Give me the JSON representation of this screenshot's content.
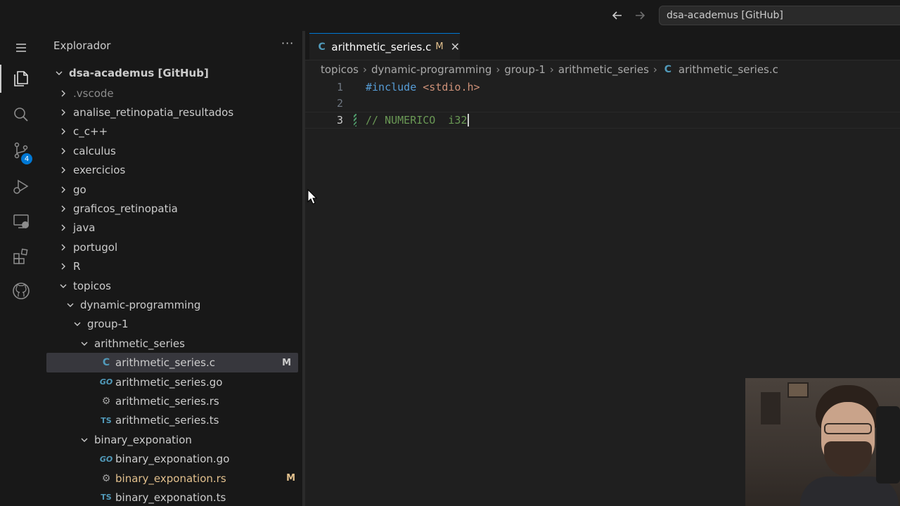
{
  "titlebar": {
    "search_text": "dsa-academus [GitHub]"
  },
  "activitybar": {
    "items": [
      "menu-icon",
      "files-icon",
      "search-icon",
      "source-control-icon",
      "run-debug-icon",
      "remote-explorer-icon",
      "extensions-icon",
      "github-icon"
    ],
    "source_control_badge": "4"
  },
  "sidebar": {
    "title": "Explorador",
    "more": "···",
    "root": "dsa-academus [GitHub]",
    "items": [
      {
        "label": ".vscode",
        "depth": 0,
        "kind": "folder",
        "expanded": false
      },
      {
        "label": "analise_retinopatia_resultados",
        "depth": 0,
        "kind": "folder",
        "expanded": false
      },
      {
        "label": "c_c++",
        "depth": 0,
        "kind": "folder",
        "expanded": false
      },
      {
        "label": "calculus",
        "depth": 0,
        "kind": "folder",
        "expanded": false
      },
      {
        "label": "exercicios",
        "depth": 0,
        "kind": "folder",
        "expanded": false
      },
      {
        "label": "go",
        "depth": 0,
        "kind": "folder",
        "expanded": false
      },
      {
        "label": "graficos_retinopatia",
        "depth": 0,
        "kind": "folder",
        "expanded": false
      },
      {
        "label": "java",
        "depth": 0,
        "kind": "folder",
        "expanded": false
      },
      {
        "label": "portugol",
        "depth": 0,
        "kind": "folder",
        "expanded": false
      },
      {
        "label": "R",
        "depth": 0,
        "kind": "folder",
        "expanded": false
      },
      {
        "label": "topicos",
        "depth": 0,
        "kind": "folder",
        "expanded": true
      },
      {
        "label": "dynamic-programming",
        "depth": 1,
        "kind": "folder",
        "expanded": true
      },
      {
        "label": "group-1",
        "depth": 2,
        "kind": "folder",
        "expanded": true
      },
      {
        "label": "arithmetic_series",
        "depth": 3,
        "kind": "folder",
        "expanded": true
      },
      {
        "label": "arithmetic_series.c",
        "depth": 4,
        "kind": "file",
        "icon": "C",
        "status": "M"
      },
      {
        "label": "arithmetic_series.go",
        "depth": 4,
        "kind": "file",
        "icon": "GO"
      },
      {
        "label": "arithmetic_series.rs",
        "depth": 4,
        "kind": "file",
        "icon": "⚙"
      },
      {
        "label": "arithmetic_series.ts",
        "depth": 4,
        "kind": "file",
        "icon": "TS"
      },
      {
        "label": "binary_exponation",
        "depth": 3,
        "kind": "folder",
        "expanded": true
      },
      {
        "label": "binary_exponation.go",
        "depth": 4,
        "kind": "file",
        "icon": "GO"
      },
      {
        "label": "binary_exponation.rs",
        "depth": 4,
        "kind": "file",
        "icon": "⚙",
        "status": "M"
      },
      {
        "label": "binary_exponation.ts",
        "depth": 4,
        "kind": "file",
        "icon": "TS"
      }
    ]
  },
  "editor": {
    "tab": {
      "icon": "C",
      "label": "arithmetic_series.c",
      "status": "M",
      "close": "✕"
    },
    "breadcrumbs": [
      "topicos",
      "dynamic-programming",
      "group-1",
      "arithmetic_series",
      "arithmetic_series.c"
    ],
    "breadcrumb_file_icon": "C",
    "lines": [
      {
        "number": "1",
        "keyword": "#include",
        "rest": " <stdio.h>"
      },
      {
        "number": "2",
        "text": ""
      },
      {
        "number": "3",
        "comment": "// NUMERICO  i32"
      }
    ]
  },
  "colors": {
    "accent": "#0078d4",
    "modified": "#e2c08d",
    "keyword": "#569cd6",
    "string": "#ce9178",
    "comment": "#6a9955"
  }
}
